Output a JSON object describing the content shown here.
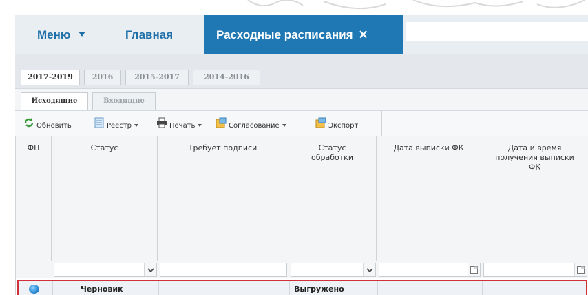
{
  "nav": {
    "menu_label": "Меню",
    "main_label": "Главная",
    "active_tab_label": "Расходные расписания",
    "close_glyph": "✕"
  },
  "year_tabs": [
    "2017-2019",
    "2016",
    "2015-2017",
    "2014-2016"
  ],
  "direction_tabs": [
    "Исходящие",
    "Входящие"
  ],
  "toolbar": {
    "refresh": "Обновить",
    "registry": "Реестр",
    "print": "Печать",
    "approval": "Согласование",
    "export": "Экспорт"
  },
  "columns": {
    "fp": "ФП",
    "status": "Статус",
    "requires_signature": "Требует подписи",
    "processing_status": "Статус обработки",
    "fk_statement_date": "Дата выписки ФК",
    "fk_statement_received": "Дата и время получения выписки ФК"
  },
  "row": {
    "status": "Черновик",
    "processing_status": "Выгружено"
  },
  "colors": {
    "accent": "#1f77b4",
    "nav_text": "#1e6fa8",
    "highlight_border": "#d0303a"
  },
  "icons": [
    "refresh-icon",
    "registry-icon",
    "print-icon",
    "approval-icon",
    "export-icon",
    "chevron-down-icon",
    "calendar-icon",
    "status-dot-icon"
  ]
}
